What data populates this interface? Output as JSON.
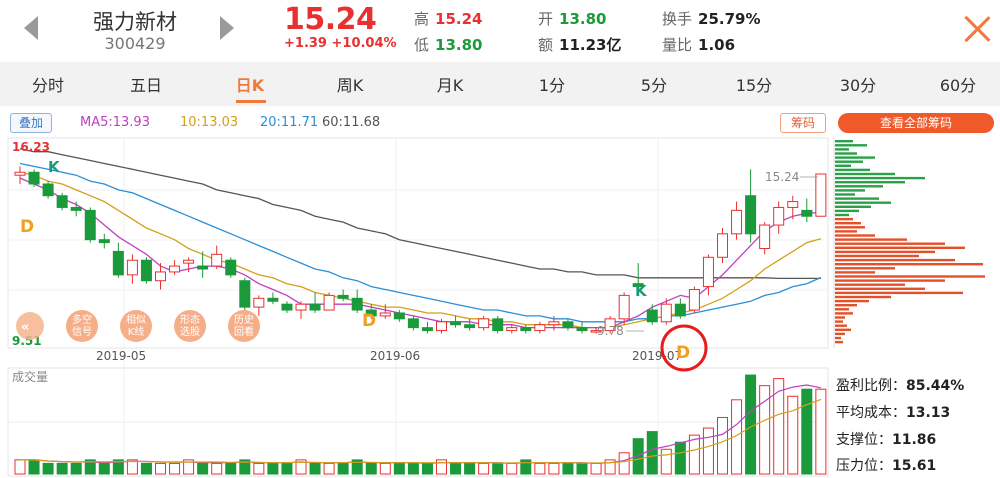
{
  "header": {
    "name": "强力新材",
    "code": "300429",
    "price": "15.24",
    "change": "+1.39",
    "change_pct": "+10.04%",
    "stats": [
      {
        "label": "高",
        "value": "15.24",
        "tone": "red"
      },
      {
        "label": "低",
        "value": "13.80",
        "tone": "green"
      },
      {
        "label": "开",
        "value": "13.80",
        "tone": "green"
      },
      {
        "label": "额",
        "value": "11.23亿",
        "tone": "dark"
      },
      {
        "label": "换手",
        "value": "25.79%",
        "tone": "dark"
      },
      {
        "label": "量比",
        "value": "1.06",
        "tone": "dark"
      }
    ]
  },
  "tabs": [
    "分时",
    "五日",
    "日K",
    "周K",
    "月K",
    "1分",
    "5分",
    "15分",
    "30分",
    "60分"
  ],
  "active_tab": 2,
  "toolbar": {
    "overlay": "叠加",
    "ma": [
      {
        "text": "MA5:13.93",
        "color": "#c040c0"
      },
      {
        "text": "10:13.03",
        "color": "#d4a017"
      },
      {
        "text": "20:11.71",
        "color": "#2a8fd8"
      },
      {
        "text": "60:11.68",
        "color": "#555555"
      }
    ],
    "chips": "筹码",
    "all_chips": "查看全部筹码"
  },
  "chart": {
    "price_max_label": "16.23",
    "price_min_label": "9.51",
    "high_marker": "15.24",
    "low_marker": "9.78",
    "dates": [
      "2019-05",
      "2019-06",
      "2019-07"
    ],
    "volume_label": "成交量",
    "signals": {
      "k": "K",
      "d": "D"
    },
    "tools": [
      "多空\n信号",
      "相似\nK线",
      "形态\n选股",
      "历史\n回看"
    ]
  },
  "chart_data": {
    "type": "candlestick",
    "ylim": [
      9.51,
      16.23
    ],
    "candles": [
      [
        15.2,
        15.5,
        14.9,
        15.3
      ],
      [
        15.3,
        15.4,
        14.8,
        14.9
      ],
      [
        14.9,
        15.0,
        14.4,
        14.5
      ],
      [
        14.5,
        14.6,
        14.0,
        14.1
      ],
      [
        14.1,
        14.3,
        13.8,
        14.0
      ],
      [
        14.0,
        14.1,
        12.9,
        13.0
      ],
      [
        13.0,
        13.2,
        12.7,
        12.9
      ],
      [
        12.6,
        12.9,
        11.7,
        11.8
      ],
      [
        11.8,
        12.5,
        11.5,
        12.3
      ],
      [
        12.3,
        12.4,
        11.5,
        11.6
      ],
      [
        11.6,
        12.2,
        11.3,
        11.9
      ],
      [
        11.9,
        12.3,
        11.8,
        12.1
      ],
      [
        12.2,
        12.4,
        11.9,
        12.3
      ],
      [
        12.1,
        12.6,
        11.7,
        12.0
      ],
      [
        12.1,
        12.8,
        12.0,
        12.5
      ],
      [
        12.3,
        12.4,
        11.7,
        11.8
      ],
      [
        11.6,
        11.7,
        10.6,
        10.7
      ],
      [
        10.7,
        11.1,
        10.4,
        11.0
      ],
      [
        11.0,
        11.2,
        10.8,
        10.9
      ],
      [
        10.8,
        10.9,
        10.5,
        10.6
      ],
      [
        10.6,
        10.9,
        10.3,
        10.8
      ],
      [
        10.8,
        11.2,
        10.5,
        10.6
      ],
      [
        10.6,
        11.2,
        10.6,
        11.1
      ],
      [
        11.1,
        11.3,
        10.9,
        11.0
      ],
      [
        11.0,
        11.3,
        10.5,
        10.6
      ],
      [
        10.6,
        10.8,
        10.3,
        10.4
      ],
      [
        10.4,
        10.8,
        10.3,
        10.5
      ],
      [
        10.5,
        10.6,
        10.2,
        10.3
      ],
      [
        10.3,
        10.4,
        9.9,
        10.0
      ],
      [
        10.0,
        10.2,
        9.8,
        9.9
      ],
      [
        9.9,
        10.3,
        9.8,
        10.2
      ],
      [
        10.2,
        10.4,
        10.0,
        10.1
      ],
      [
        10.1,
        10.3,
        9.9,
        10.0
      ],
      [
        10.0,
        10.4,
        9.9,
        10.3
      ],
      [
        10.3,
        10.4,
        9.8,
        9.9
      ],
      [
        9.9,
        10.1,
        9.8,
        10.0
      ],
      [
        10.0,
        10.1,
        9.8,
        9.9
      ],
      [
        9.9,
        10.2,
        9.8,
        10.1
      ],
      [
        10.1,
        10.4,
        9.9,
        10.2
      ],
      [
        10.2,
        10.3,
        9.9,
        10.0
      ],
      [
        10.0,
        10.2,
        9.8,
        9.9
      ],
      [
        9.9,
        10.0,
        9.8,
        9.9
      ],
      [
        9.9,
        10.4,
        9.8,
        10.3
      ],
      [
        10.3,
        11.2,
        10.1,
        11.1
      ],
      [
        11.5,
        12.2,
        11.2,
        11.4
      ],
      [
        10.6,
        10.8,
        10.1,
        10.2
      ],
      [
        10.2,
        11.0,
        10.1,
        10.8
      ],
      [
        10.8,
        11.0,
        10.3,
        10.4
      ],
      [
        10.6,
        11.4,
        10.5,
        11.3
      ],
      [
        11.4,
        12.5,
        11.1,
        12.4
      ],
      [
        12.4,
        13.4,
        12.2,
        13.2
      ],
      [
        13.2,
        14.3,
        13.0,
        14.0
      ],
      [
        14.5,
        15.4,
        12.9,
        13.2
      ],
      [
        12.7,
        13.6,
        12.5,
        13.5
      ],
      [
        13.5,
        14.3,
        13.2,
        14.1
      ],
      [
        14.1,
        14.5,
        13.7,
        14.3
      ],
      [
        14.0,
        14.4,
        13.6,
        13.8
      ],
      [
        13.8,
        15.24,
        13.8,
        15.24
      ]
    ],
    "volumes": [
      4,
      4,
      3,
      3,
      3,
      4,
      3,
      4,
      4,
      3,
      3,
      3,
      4,
      3,
      3,
      3,
      4,
      3,
      3,
      3,
      4,
      3,
      3,
      3,
      4,
      3,
      3,
      3,
      3,
      3,
      4,
      3,
      3,
      3,
      3,
      3,
      4,
      3,
      3,
      3,
      3,
      3,
      4,
      6,
      10,
      12,
      7,
      9,
      11,
      13,
      16,
      21,
      28,
      25,
      27,
      22,
      24,
      24
    ],
    "ma5": [
      15.1,
      14.9,
      14.7,
      14.4,
      14.2,
      13.9,
      13.5,
      13.1,
      12.8,
      12.5,
      12.1,
      11.9,
      12.0,
      12.1,
      12.1,
      12.0,
      11.8,
      11.5,
      11.3,
      11.1,
      10.8,
      10.8,
      10.8,
      10.8,
      10.8,
      10.7,
      10.6,
      10.5,
      10.4,
      10.3,
      10.2,
      10.2,
      10.2,
      10.1,
      10.1,
      10.1,
      10.0,
      10.0,
      10.0,
      10.0,
      10.0,
      10.0,
      10.0,
      10.2,
      10.4,
      10.7,
      10.9,
      11.1,
      11.0,
      11.4,
      11.8,
      12.3,
      12.8,
      13.3,
      13.6,
      13.8,
      13.9,
      13.93
    ],
    "ma10": [
      15.3,
      15.2,
      15.0,
      14.9,
      14.7,
      14.5,
      14.3,
      14.0,
      13.7,
      13.4,
      13.2,
      13.0,
      12.7,
      12.5,
      12.3,
      12.2,
      12.0,
      11.8,
      11.7,
      11.5,
      11.4,
      11.2,
      11.1,
      11.0,
      10.9,
      10.8,
      10.7,
      10.7,
      10.6,
      10.5,
      10.5,
      10.4,
      10.3,
      10.3,
      10.2,
      10.2,
      10.1,
      10.1,
      10.1,
      10.1,
      10.0,
      10.0,
      10.0,
      10.1,
      10.2,
      10.3,
      10.4,
      10.5,
      10.6,
      10.8,
      11.0,
      11.3,
      11.6,
      12.0,
      12.3,
      12.6,
      12.9,
      13.03
    ],
    "ma20": [
      15.6,
      15.5,
      15.4,
      15.3,
      15.2,
      15.0,
      14.9,
      14.7,
      14.6,
      14.4,
      14.2,
      14.0,
      13.8,
      13.6,
      13.4,
      13.2,
      13.0,
      12.8,
      12.6,
      12.4,
      12.2,
      12.0,
      11.9,
      11.7,
      11.6,
      11.4,
      11.3,
      11.2,
      11.1,
      11.0,
      10.9,
      10.8,
      10.7,
      10.6,
      10.6,
      10.5,
      10.4,
      10.4,
      10.3,
      10.3,
      10.2,
      10.2,
      10.2,
      10.2,
      10.3,
      10.3,
      10.4,
      10.4,
      10.5,
      10.6,
      10.7,
      10.8,
      10.9,
      11.1,
      11.2,
      11.4,
      11.5,
      11.71
    ],
    "ma60": [
      16.1,
      16.0,
      16.0,
      15.9,
      15.8,
      15.7,
      15.6,
      15.5,
      15.4,
      15.3,
      15.2,
      15.1,
      15.0,
      14.9,
      14.7,
      14.6,
      14.5,
      14.4,
      14.2,
      14.1,
      14.0,
      13.8,
      13.7,
      13.6,
      13.4,
      13.3,
      13.2,
      13.0,
      12.9,
      12.8,
      12.7,
      12.6,
      12.5,
      12.4,
      12.3,
      12.2,
      12.1,
      12.0,
      12.0,
      11.9,
      11.9,
      11.8,
      11.8,
      11.8,
      11.7,
      11.7,
      11.7,
      11.7,
      11.7,
      11.7,
      11.7,
      11.7,
      11.7,
      11.7,
      11.68,
      11.68,
      11.68,
      11.68
    ],
    "colors": {
      "up": "#e93030",
      "down": "#1a9a3a",
      "ma5": "#c040c0",
      "ma10": "#d4a017",
      "ma20": "#2a8fd8",
      "ma60": "#555555"
    }
  },
  "side": {
    "profit_label": "盈利比例：",
    "profit": "85.44%",
    "cost_label": "平均成本：",
    "cost": "13.13",
    "support_label": "支撑位：",
    "support": "11.86",
    "pressure_label": "压力位：",
    "pressure": "15.61"
  }
}
